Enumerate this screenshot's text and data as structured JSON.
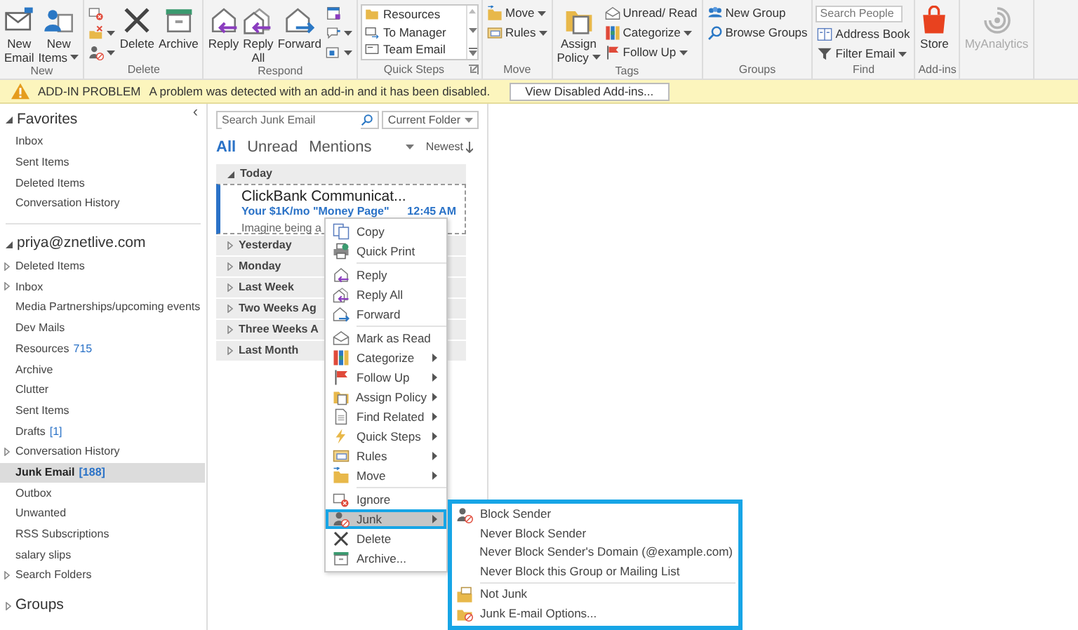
{
  "ribbon": {
    "groups": [
      {
        "label": "New",
        "items": [
          {
            "kind": "large",
            "label": "New\nEmail"
          },
          {
            "kind": "large",
            "label": "New\nItems",
            "dropdown": true
          }
        ]
      },
      {
        "label": "Delete",
        "items": [
          {
            "kind": "icon"
          },
          {
            "kind": "icon",
            "dropdown": true
          },
          {
            "kind": "icon",
            "dropdown": true
          },
          {
            "kind": "large",
            "label": "Delete"
          },
          {
            "kind": "large",
            "label": "Archive"
          }
        ]
      },
      {
        "label": "Respond",
        "items": [
          {
            "kind": "large",
            "label": "Reply"
          },
          {
            "kind": "large",
            "label": "Reply\nAll"
          },
          {
            "kind": "large",
            "label": "Forward"
          },
          {
            "kind": "icon"
          },
          {
            "kind": "icon",
            "dropdown": true
          },
          {
            "kind": "icon",
            "dropdown": true
          }
        ]
      },
      {
        "label": "Quick Steps",
        "launcher": true,
        "items": [
          {
            "kind": "gallery",
            "entries": [
              "Resources",
              "To Manager",
              "Team Email"
            ]
          }
        ]
      },
      {
        "label": "Move",
        "items": [
          {
            "kind": "small",
            "label": "Move",
            "dropdown": true
          },
          {
            "kind": "small",
            "label": "Rules",
            "dropdown": true
          }
        ]
      },
      {
        "label": "Tags",
        "items": [
          {
            "kind": "large",
            "label": "Assign\nPolicy",
            "dropdown": true
          },
          {
            "kind": "small",
            "label": "Unread/ Read"
          },
          {
            "kind": "small",
            "label": "Categorize",
            "dropdown": true
          },
          {
            "kind": "small",
            "label": "Follow Up",
            "dropdown": true
          }
        ]
      },
      {
        "label": "Groups",
        "items": [
          {
            "kind": "small",
            "label": "New Group"
          },
          {
            "kind": "small",
            "label": "Browse Groups"
          }
        ]
      },
      {
        "label": "Find",
        "items": [
          {
            "kind": "search",
            "placeholder": "Search People"
          },
          {
            "kind": "small",
            "label": "Address Book"
          },
          {
            "kind": "small",
            "label": "Filter Email",
            "dropdown": true
          }
        ]
      },
      {
        "label": "Add-ins",
        "items": [
          {
            "kind": "large",
            "label": "Store"
          }
        ]
      },
      {
        "items": [
          {
            "kind": "large",
            "label": "MyAnalytics",
            "disabled": true
          }
        ]
      }
    ]
  },
  "infobar": {
    "title": "ADD-IN PROBLEM",
    "message": "A problem was detected with an add-in and it has been disabled.",
    "button": "View Disabled Add-ins..."
  },
  "folder_pane": {
    "collapse": "‹",
    "sections": [
      {
        "label": "Favorites",
        "expanded": true,
        "items": [
          {
            "label": "Inbox",
            "selected": false
          },
          {
            "label": "Sent Items",
            "selected": false
          },
          {
            "label": "Deleted Items",
            "selected": false
          },
          {
            "label": "Conversation History",
            "selected": false
          }
        ]
      },
      {
        "label": "priya@znetlive.com",
        "expanded": true,
        "items": [
          {
            "label": "Deleted Items",
            "has_children": true,
            "selected": false
          },
          {
            "label": "Inbox",
            "has_children": true,
            "selected": false
          },
          {
            "label": "Media Partnerships/upcoming events",
            "selected": false
          },
          {
            "label": "Dev Mails",
            "selected": false
          },
          {
            "label": "Resources",
            "count": "715",
            "selected": false
          },
          {
            "label": "Archive",
            "selected": false
          },
          {
            "label": "Clutter",
            "selected": false
          },
          {
            "label": "Sent Items",
            "selected": false
          },
          {
            "label": "Drafts",
            "count": "[1]",
            "selected": false
          },
          {
            "label": "Conversation History",
            "has_children": true,
            "selected": false
          },
          {
            "label": "Junk Email",
            "count": "[188]",
            "selected": true
          },
          {
            "label": "Outbox",
            "selected": false
          },
          {
            "label": "Unwanted",
            "selected": false
          },
          {
            "label": "RSS Subscriptions",
            "selected": false
          },
          {
            "label": "salary slips",
            "selected": false
          },
          {
            "label": "Search Folders",
            "has_children": true,
            "selected": false
          }
        ]
      },
      {
        "label": "Groups",
        "expanded": false
      }
    ]
  },
  "message_list": {
    "search": {
      "placeholder": "Search Junk Email"
    },
    "scope": "Current Folder",
    "filters": [
      {
        "label": "All",
        "selected": true
      },
      {
        "label": "Unread",
        "selected": false
      },
      {
        "label": "Mentions",
        "selected": false
      }
    ],
    "sort": "Newest",
    "groups": [
      {
        "label": "Today",
        "expanded": true,
        "messages": [
          {
            "sender": "ClickBank Communicat...",
            "subject": "Your $1K/mo \"Money Page\"",
            "time": "12:45 AM",
            "preview": "Imagine being a"
          }
        ]
      },
      {
        "label": "Yesterday",
        "expanded": false
      },
      {
        "label": "Monday",
        "expanded": false
      },
      {
        "label": "Last Week",
        "expanded": false
      },
      {
        "label": "Two Weeks Ag",
        "expanded": false
      },
      {
        "label": "Three Weeks A",
        "expanded": false
      },
      {
        "label": "Last Month",
        "expanded": false
      }
    ]
  },
  "context_menu": {
    "sections": [
      [
        {
          "label": "Copy"
        },
        {
          "label": "Quick Print"
        }
      ],
      [
        {
          "label": "Reply"
        },
        {
          "label": "Reply All"
        },
        {
          "label": "Forward"
        }
      ],
      [
        {
          "label": "Mark as Read"
        },
        {
          "label": "Categorize",
          "submenu": true
        },
        {
          "label": "Follow Up",
          "submenu": true
        },
        {
          "label": "Assign Policy",
          "submenu": true
        },
        {
          "label": "Find Related",
          "submenu": true
        },
        {
          "label": "Quick Steps",
          "submenu": true
        },
        {
          "label": "Rules",
          "submenu": true
        },
        {
          "label": "Move",
          "submenu": true
        }
      ],
      [
        {
          "label": "Ignore"
        },
        {
          "label": "Junk",
          "submenu": true,
          "highlighted": true,
          "outlined": true
        },
        {
          "label": "Delete"
        },
        {
          "label": "Archive..."
        }
      ]
    ]
  },
  "junk_submenu": {
    "outlined": true,
    "sections": [
      [
        "Block Sender",
        "Never Block Sender",
        "Never Block Sender's Domain (@example.com)",
        "Never Block this Group or Mailing List"
      ],
      [
        "Not Junk",
        "Junk E-mail Options..."
      ]
    ]
  }
}
